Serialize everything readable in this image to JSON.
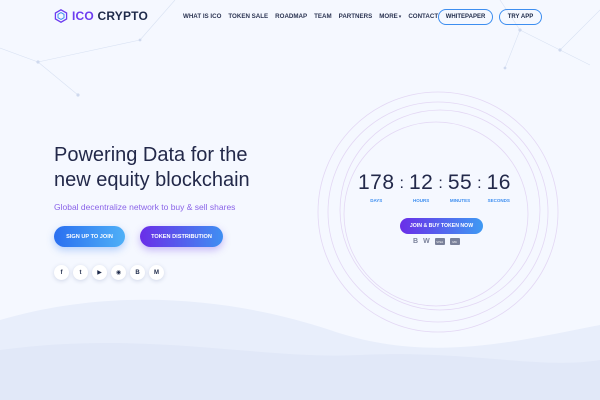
{
  "brand": {
    "name_part1": "ICO",
    "name_part2": "CRYPTO"
  },
  "nav": {
    "items": [
      "WHAT IS ICO",
      "TOKEN SALE",
      "ROADMAP",
      "TEAM",
      "PARTNERS",
      "MORE",
      "CONTACT"
    ],
    "more_caret": "▾"
  },
  "header": {
    "whitepaper_label": "WHITEPAPER",
    "try_app_label": "TRY APP"
  },
  "hero": {
    "headline_line1": "Powering Data for the",
    "headline_line2": "new equity blockchain",
    "subheadline": "Global decentralize network to buy & sell shares",
    "signup_label": "SIGN UP TO JOIN",
    "distribution_label": "TOKEN DISTRIBUTION"
  },
  "socials": [
    {
      "icon": "facebook-icon",
      "glyph": "f"
    },
    {
      "icon": "twitter-icon",
      "glyph": "t"
    },
    {
      "icon": "youtube-icon",
      "glyph": "▶"
    },
    {
      "icon": "github-icon",
      "glyph": "◉"
    },
    {
      "icon": "bitcoin-icon",
      "glyph": "B"
    },
    {
      "icon": "medium-icon",
      "glyph": "M"
    }
  ],
  "countdown": {
    "days": "178",
    "hours": "12",
    "minutes": "55",
    "seconds": "16",
    "separator": ":",
    "days_label": "DAYS",
    "hours_label": "HOURS",
    "minutes_label": "MINUTES",
    "seconds_label": "SECONDS"
  },
  "buy": {
    "label": "JOIN & BUY TOKEN NOW"
  },
  "payments": [
    {
      "icon": "bitcoin-icon",
      "glyph": "B"
    },
    {
      "icon": "wemoney-icon",
      "glyph": "W"
    },
    {
      "icon": "visa-card-icon",
      "glyph": "VISA"
    },
    {
      "icon": "mastercard-icon",
      "glyph": "MC"
    }
  ],
  "colors": {
    "accent_purple": "#6d3cf0",
    "accent_blue": "#3d8ef0",
    "text_dark": "#1e2a4a",
    "background": "#f5f8ff"
  }
}
